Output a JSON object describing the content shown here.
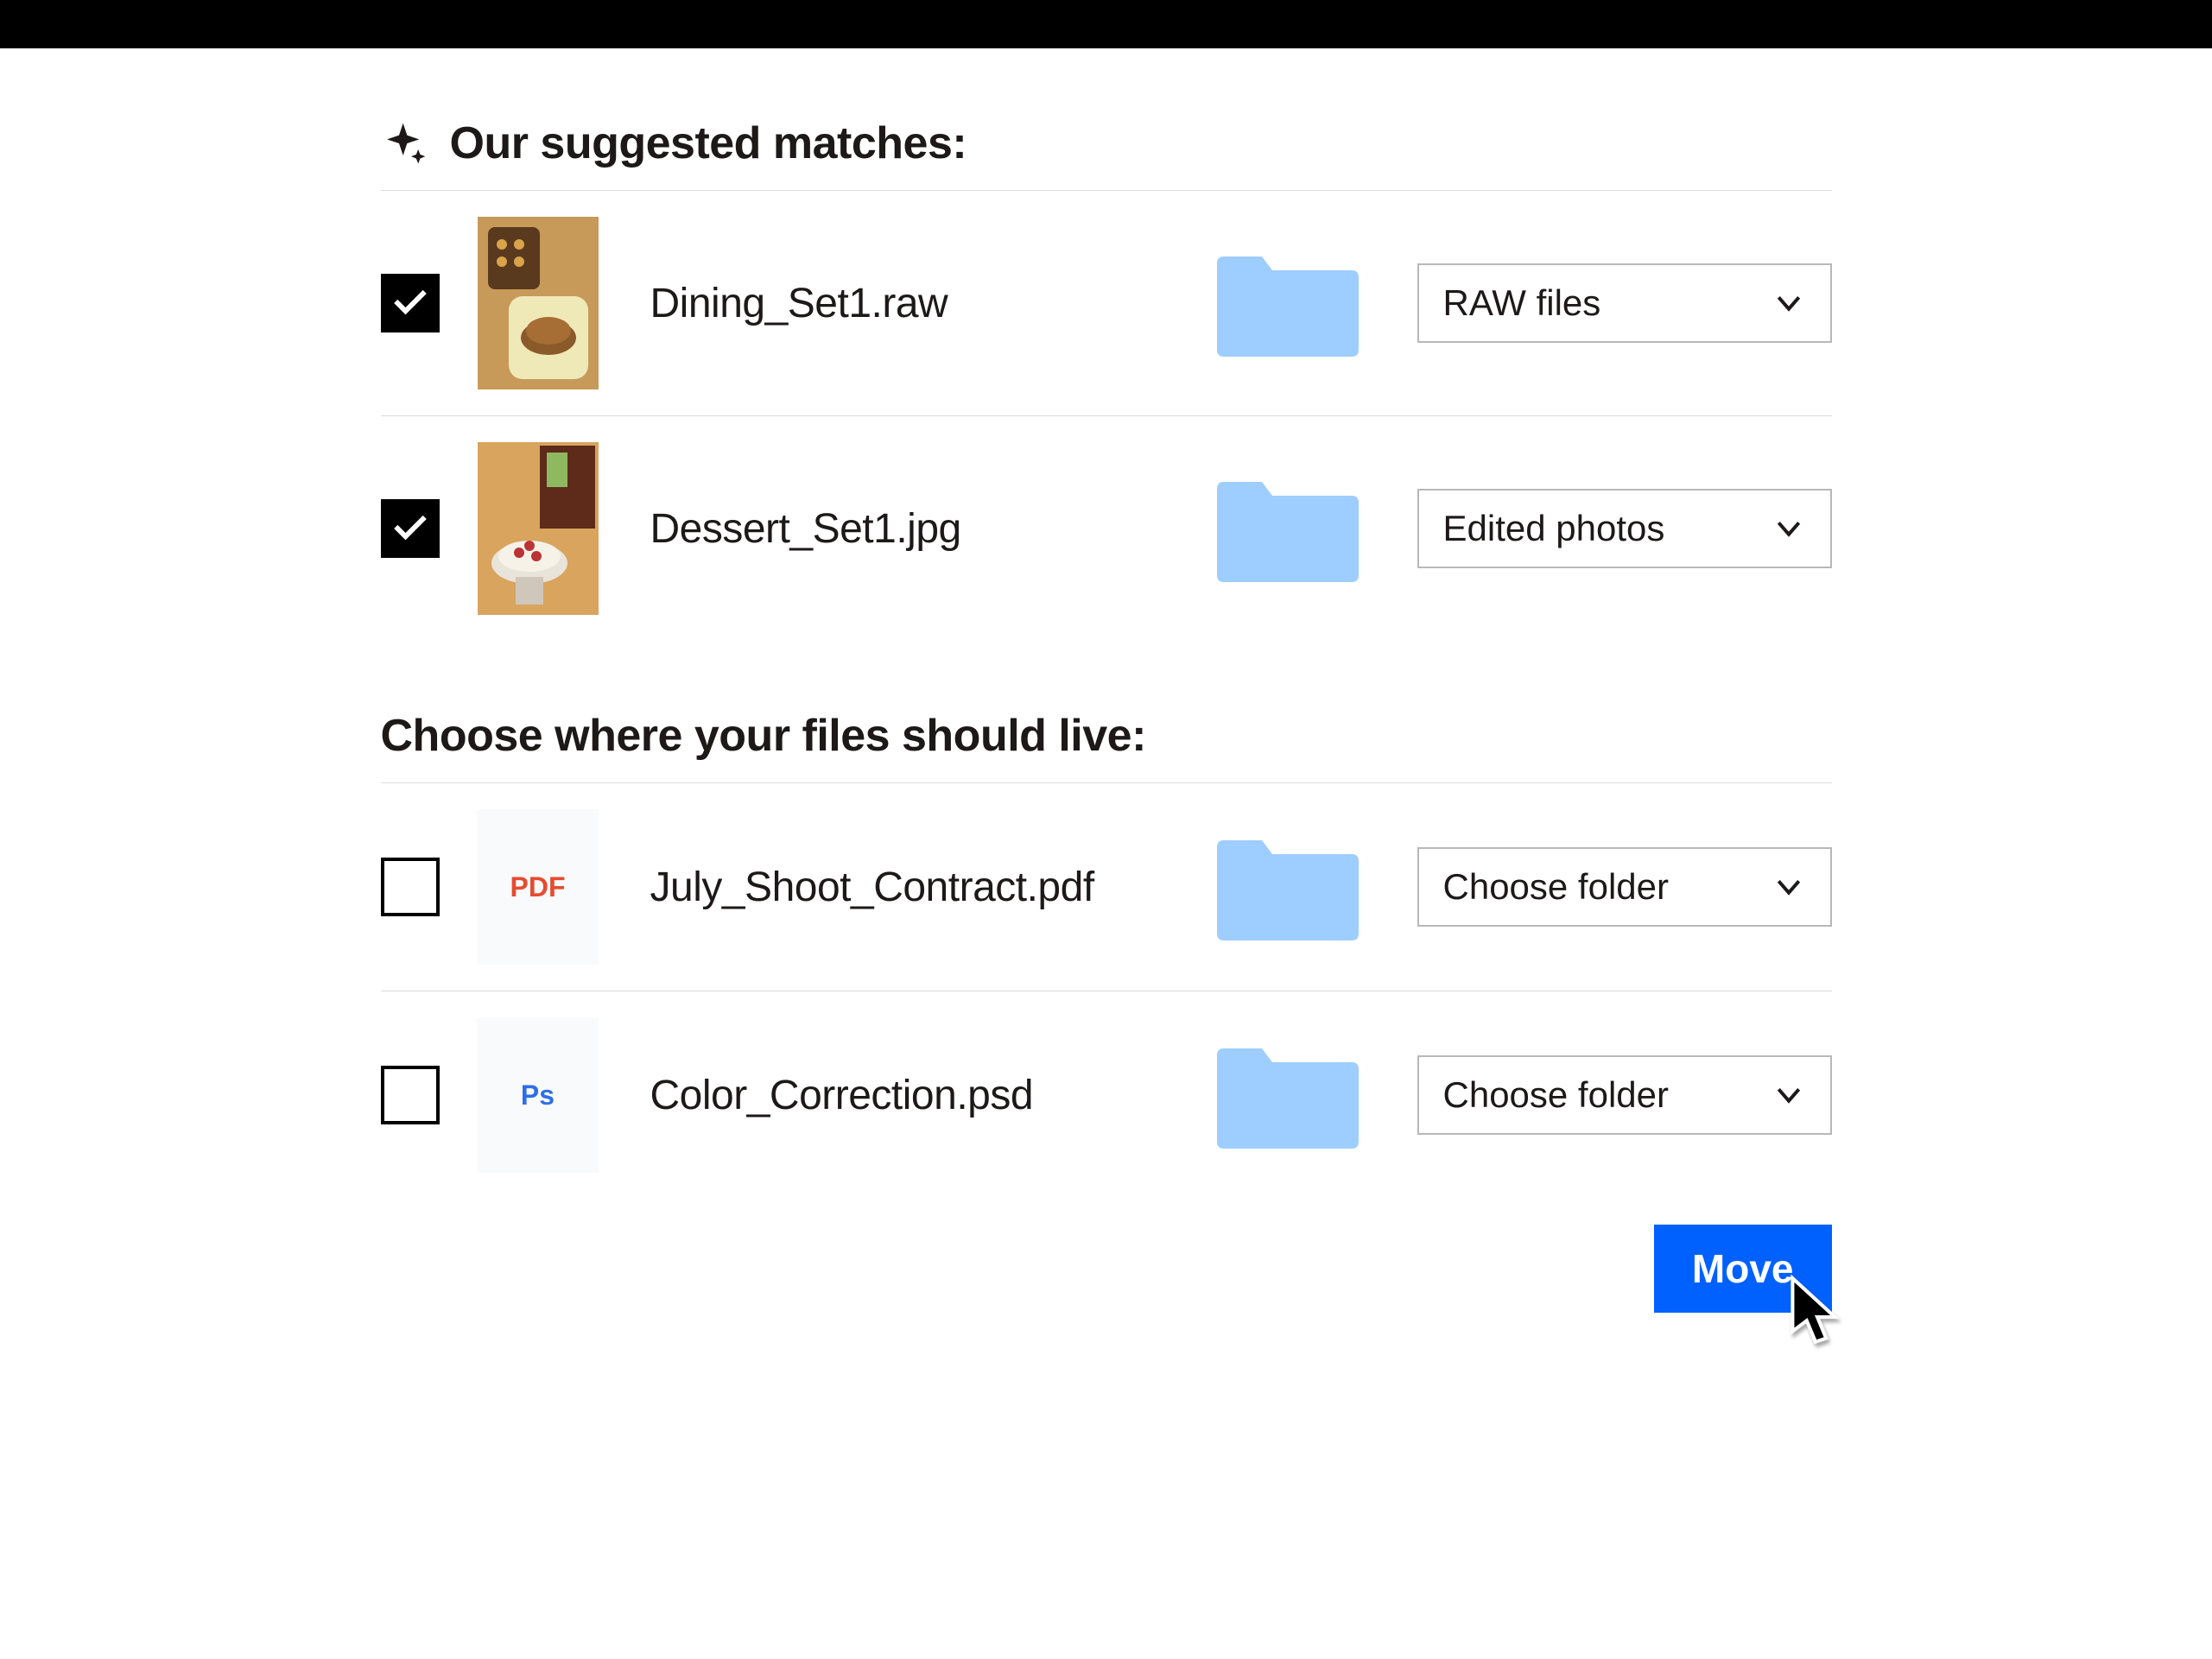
{
  "sections": {
    "suggested": {
      "title": "Our suggested matches:"
    },
    "choose": {
      "title": "Choose where your files should live:"
    }
  },
  "suggested_rows": [
    {
      "checked": true,
      "filename": "Dining_Set1.raw",
      "folder_label": "RAW files",
      "thumb": "photo"
    },
    {
      "checked": true,
      "filename": "Dessert_Set1.jpg",
      "folder_label": "Edited photos",
      "thumb": "photo"
    }
  ],
  "choose_rows": [
    {
      "checked": false,
      "filename": "July_Shoot_Contract.pdf",
      "folder_label": "Choose folder",
      "ext": "PDF"
    },
    {
      "checked": false,
      "filename": "Color_Correction.psd",
      "folder_label": "Choose folder",
      "ext": "Ps"
    }
  ],
  "actions": {
    "move_label": "Move"
  },
  "colors": {
    "folder": "#9ecdff",
    "primary": "#0061fe"
  }
}
